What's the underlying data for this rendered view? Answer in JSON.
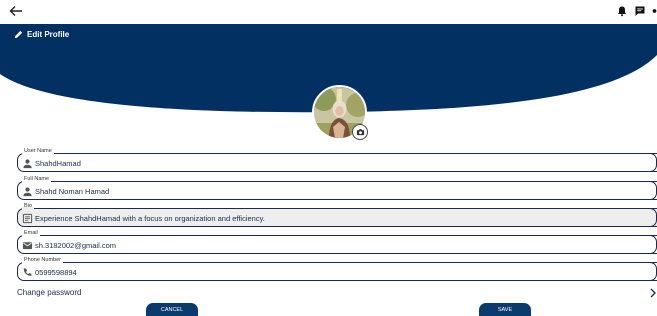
{
  "header": {
    "title": "Edit Profile"
  },
  "fields": [
    {
      "label": "User Name",
      "value": "ShahdHamad",
      "icon": "person-icon"
    },
    {
      "label": "Full Name",
      "value": "Shahd Noman Hamad",
      "icon": "person-icon"
    },
    {
      "label": "Bio",
      "value": "Experience ShahdHamad with a focus on organization and efficiency.",
      "icon": "notes-icon"
    },
    {
      "label": "Email",
      "value": "sh.3182002@gmail.com",
      "icon": "mail-icon"
    },
    {
      "label": "Phone Number",
      "value": "0599598894",
      "icon": "phone-icon"
    }
  ],
  "change_password": "Change password",
  "actions": {
    "cancel": "CANCEL",
    "save": "SAVE"
  },
  "colors": {
    "primary": "#033063",
    "button": "#0b3a6e",
    "text": "#1b2a4a"
  }
}
